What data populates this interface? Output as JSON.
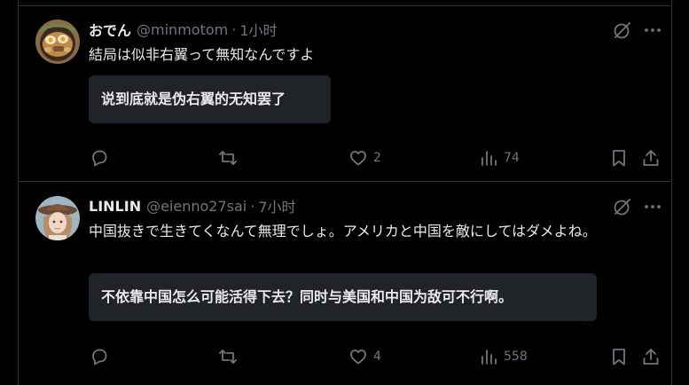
{
  "posts": [
    {
      "display_name": "おでん",
      "handle": "@minmotom",
      "time": "1小时",
      "separator": "·",
      "text": "結局は似非右翼って無知なんですよ",
      "translation": "说到底就是伪右翼的无知罢了",
      "likes": "2",
      "views": "74",
      "avatar_icon": "oden-food-avatar"
    },
    {
      "display_name": "LINLIN",
      "handle": "@eienno27sai",
      "time": "7小时",
      "separator": "·",
      "text": "中国抜きで生きてくなんて無理でしょ。アメリカと中国を敵にしてはダメよね。",
      "translation": "不依靠中国怎么可能活得下去？同时与美国和中国为敌可不行啊。",
      "likes": "4",
      "views": "558",
      "avatar_icon": "anime-girl-avatar"
    }
  ],
  "icons": {
    "reply": "reply-icon",
    "retweet": "retweet-icon",
    "like": "heart-icon",
    "views": "views-icon",
    "bookmark": "bookmark-icon",
    "share": "share-icon",
    "grok": "grok-icon",
    "more": "more-icon"
  },
  "colors": {
    "background": "#000000",
    "text": "#e7e9ea",
    "muted": "#71767b",
    "border": "#2f3336",
    "translation_bg": "#202327"
  }
}
